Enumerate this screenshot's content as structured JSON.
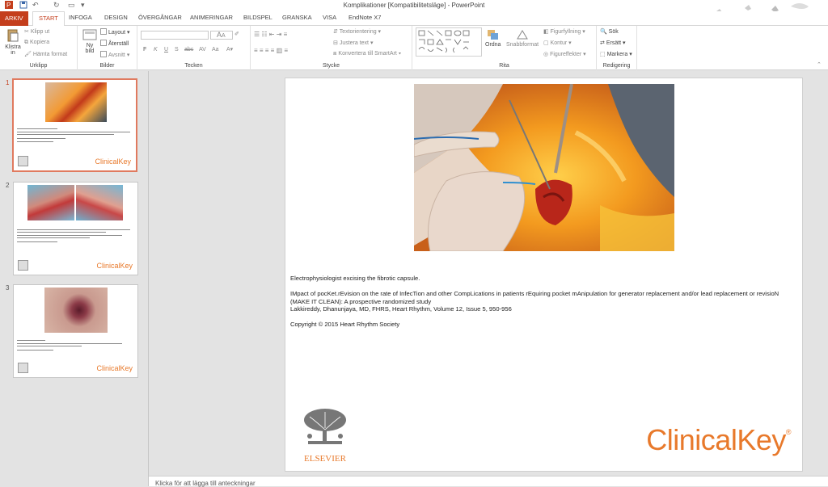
{
  "window": {
    "title": "Komplikationer [Kompatibilitetsläge] - PowerPoint"
  },
  "tabs": [
    "ARKIV",
    "START",
    "INFOGA",
    "DESIGN",
    "ÖVERGÅNGAR",
    "ANIMERINGAR",
    "BILDSPEL",
    "GRANSKA",
    "VISA",
    "EndNote X7"
  ],
  "ribbon": {
    "urklipp": {
      "label": "Urklipp",
      "paste": "Klistra",
      "paste_sub": "in",
      "cut": "Klipp ut",
      "copy": "Kopiera",
      "format_painter": "Hämta format"
    },
    "bilder": {
      "label": "Bilder",
      "new_slide": "Ny",
      "new_slide_sub": "bild",
      "layout": "Layout",
      "reset": "Återställ",
      "section": "Avsnitt"
    },
    "tecken": {
      "label": "Tecken",
      "bold": "F",
      "italic": "K",
      "underline": "U",
      "strike": "S",
      "shadow": "abc",
      "spacing": "AV",
      "case": "Aa",
      "font_grow": "A",
      "font_shrink": "A"
    },
    "stycke": {
      "label": "Stycke",
      "text_direction": "Textorientering",
      "align_text": "Justera text",
      "smartart": "Konvertera till SmartArt"
    },
    "rita": {
      "label": "Rita",
      "arrange": "Ordna",
      "quick_styles": "Snabbformat",
      "fill": "Figurfyllning",
      "outline": "Kontur",
      "effects": "Figureffekter"
    },
    "redigering": {
      "label": "Redigering",
      "find": "Sök",
      "replace": "Ersätt",
      "select": "Markera"
    }
  },
  "thumbnails": [
    {
      "number": "1",
      "logo": "ClinicalKey",
      "selected": true
    },
    {
      "number": "2",
      "logo": "ClinicalKey",
      "selected": false
    },
    {
      "number": "3",
      "logo": "ClinicalKey",
      "selected": false
    }
  ],
  "slide": {
    "caption": "Electrophysiologist excising the fibrotic capsule.",
    "citation_title": "IMpact of pocKet.rEvision on the rate of InfecTion and other CompLications in patients rEquiring pocket mAnipulation for generator replacement and/or lead replacement or revisioN (MAKE IT CLEAN): A prospective randomized study",
    "citation_authors": "Lakkireddy, Dhanunjaya, MD, FHRS, Heart Rhythm, Volume 12, Issue 5, 950-956",
    "copyright": "Copyright ©  2015   Heart Rhythm Society",
    "publisher_logo": "ELSEVIER",
    "brand_logo": "ClinicalKey",
    "brand_mark": "®"
  },
  "notes": {
    "placeholder": "Klicka för att lägga till anteckningar"
  },
  "colors": {
    "accent": "#c43e1c",
    "brand": "#e8792b"
  }
}
